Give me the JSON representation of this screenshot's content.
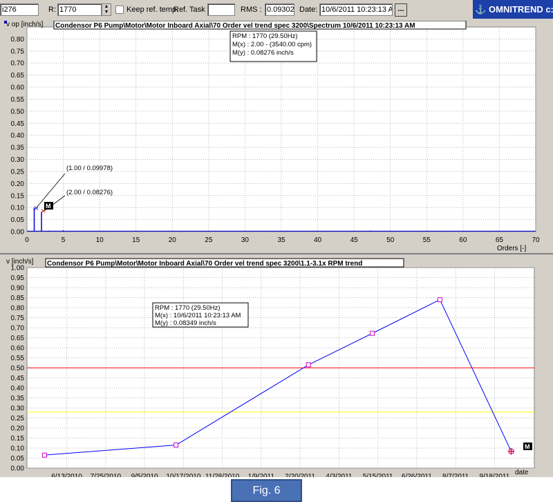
{
  "toolbar": {
    "id_field": "i276",
    "r_label": "R:",
    "r_value": "1770",
    "keep_ref_label": "Keep ref. temp.",
    "ref_task_label": "Ref. Task",
    "rms_label": "RMS :",
    "rms_value": "0.09302",
    "date_label": "Date:",
    "date_value": "10/6/2011 10:23:13 A",
    "browse_label": "...",
    "brand": "OMNITREND c:\\"
  },
  "spectrum": {
    "title": "Condensor P6 Pump\\Motor\\Motor Inboard Axial\\70 Order vel trend spec 3200\\Spectrum 10/6/2011 10:23:13 AM",
    "ylabel": "v op [inch/s]",
    "xlabel": "Orders [-]",
    "info": [
      "RPM : 1770 (29.50Hz)",
      "M(x) : 2.00 - (3540.00 cpm)",
      "M(y) : 0.08276 inch/s"
    ],
    "annotations": [
      "(1.00 / 0.09978)",
      "(2.00 / 0.08276)"
    ],
    "marker_label": "M",
    "series_color": "#0000cc",
    "marker_color": "#cc0000"
  },
  "trend": {
    "title": "Condensor P6 Pump\\Motor\\Motor Inboard Axial\\70 Order vel trend spec 3200\\1.1-3.1x RPM trend",
    "ylabel": "v [inch/s]",
    "xlabel": "date",
    "info": [
      "RPM : 1770 (29.50Hz)",
      "M(x) : 10/6/2011 10:23:13 AM",
      "M(y) : 0.08349 inch/s"
    ],
    "marker_label": "M",
    "line_color": "#0000ff",
    "point_color": "#cc00cc",
    "alarm_color": "#ff0000",
    "warning_color": "#ffff00"
  },
  "caption": "Fig. 6",
  "chart_data": [
    {
      "type": "line",
      "title": "Condensor P6 Pump\\Motor\\Motor Inboard Axial\\70 Order vel trend spec 3200\\Spectrum 10/6/2011 10:23:13 AM",
      "xlabel": "Orders [-]",
      "ylabel": "v op [inch/s]",
      "xlim": [
        0,
        70
      ],
      "ylim": [
        0,
        0.85
      ],
      "xticks": [
        0,
        5,
        10,
        15,
        20,
        25,
        30,
        35,
        40,
        45,
        50,
        55,
        60,
        65,
        70
      ],
      "yticks": [
        0.0,
        0.05,
        0.1,
        0.15,
        0.2,
        0.25,
        0.3,
        0.35,
        0.4,
        0.45,
        0.5,
        0.55,
        0.6,
        0.65,
        0.7,
        0.75,
        0.8
      ],
      "grid": true,
      "peaks": [
        {
          "x": 1.0,
          "y": 0.09978
        },
        {
          "x": 2.0,
          "y": 0.08276
        },
        {
          "x": 5.0,
          "y": 0.006
        },
        {
          "x": 3.0,
          "y": 0.004
        },
        {
          "x": 47.3,
          "y": 0.004
        },
        {
          "x": 60.5,
          "y": 0.003
        }
      ],
      "noise_floor": 0.002,
      "cursor": {
        "x": 2.0,
        "y": 0.08276
      }
    },
    {
      "type": "line",
      "title": "Condensor P6 Pump\\Motor\\Motor Inboard Axial\\70 Order vel trend spec 3200\\1.1-3.1x RPM trend",
      "xlabel": "date",
      "ylabel": "v [inch/s]",
      "ylim": [
        0,
        1.0
      ],
      "yticks": [
        0.0,
        0.05,
        0.1,
        0.15,
        0.2,
        0.25,
        0.3,
        0.35,
        0.4,
        0.45,
        0.5,
        0.55,
        0.6,
        0.65,
        0.7,
        0.75,
        0.8,
        0.85,
        0.9,
        0.95,
        1.0
      ],
      "xlim": [
        "5/1/2010",
        "10/31/2011"
      ],
      "xticks": [
        "6/13/2010",
        "7/25/2010",
        "9/5/2010",
        "10/17/2010",
        "11/28/2010",
        "1/9/2011",
        "2/20/2011",
        "4/3/2011",
        "5/15/2011",
        "6/26/2011",
        "8/7/2011",
        "9/18/2011"
      ],
      "grid": true,
      "series": [
        {
          "x": [
            "5/20/2010",
            "10/9/2010",
            "3/1/2011",
            "5/9/2011",
            "7/21/2011",
            "10/6/2011"
          ],
          "values": [
            0.065,
            0.115,
            0.515,
            0.672,
            0.84,
            0.08349
          ]
        }
      ],
      "alarm_level": 0.5,
      "warning_level": 0.28,
      "cursor": {
        "x": "10/6/2011",
        "y": 0.08349
      }
    }
  ]
}
